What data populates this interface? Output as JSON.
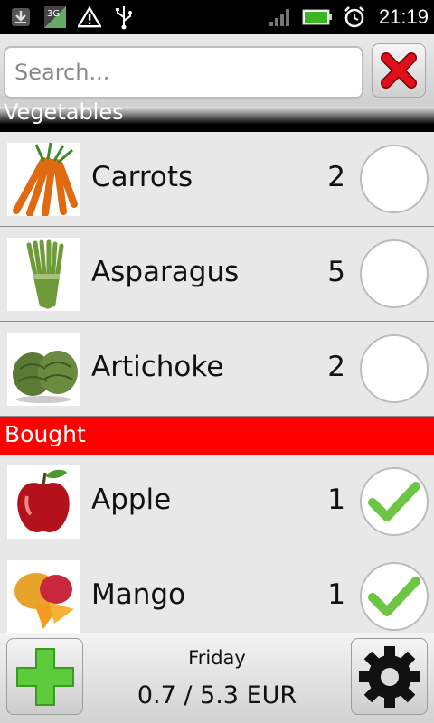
{
  "status_bar": {
    "time": "21:19",
    "icons": [
      "download-icon",
      "3g-data-icon",
      "warning-icon",
      "usb-icon",
      "signal-icon",
      "battery-icon",
      "alarm-icon"
    ],
    "network_label": "3G"
  },
  "search": {
    "placeholder": "Search...",
    "value": ""
  },
  "sections": {
    "vegetables": "Vegetables",
    "bought": "Bought"
  },
  "items": [
    {
      "name": "Carrots",
      "qty": "2",
      "checked": false,
      "image": "carrots-image"
    },
    {
      "name": "Asparagus",
      "qty": "5",
      "checked": false,
      "image": "asparagus-image"
    },
    {
      "name": "Artichoke",
      "qty": "2",
      "checked": false,
      "image": "artichoke-image"
    }
  ],
  "bought_items": [
    {
      "name": "Apple",
      "qty": "1",
      "checked": true,
      "image": "apple-image"
    },
    {
      "name": "Mango",
      "qty": "1",
      "checked": true,
      "image": "mango-image"
    }
  ],
  "footer": {
    "day": "Friday",
    "total": "0.7 / 5.3 EUR"
  },
  "colors": {
    "bought_header": "#ff0000",
    "check_green": "#6cc644",
    "add_green": "#5ccc3a",
    "clear_red": "#e0101a"
  }
}
